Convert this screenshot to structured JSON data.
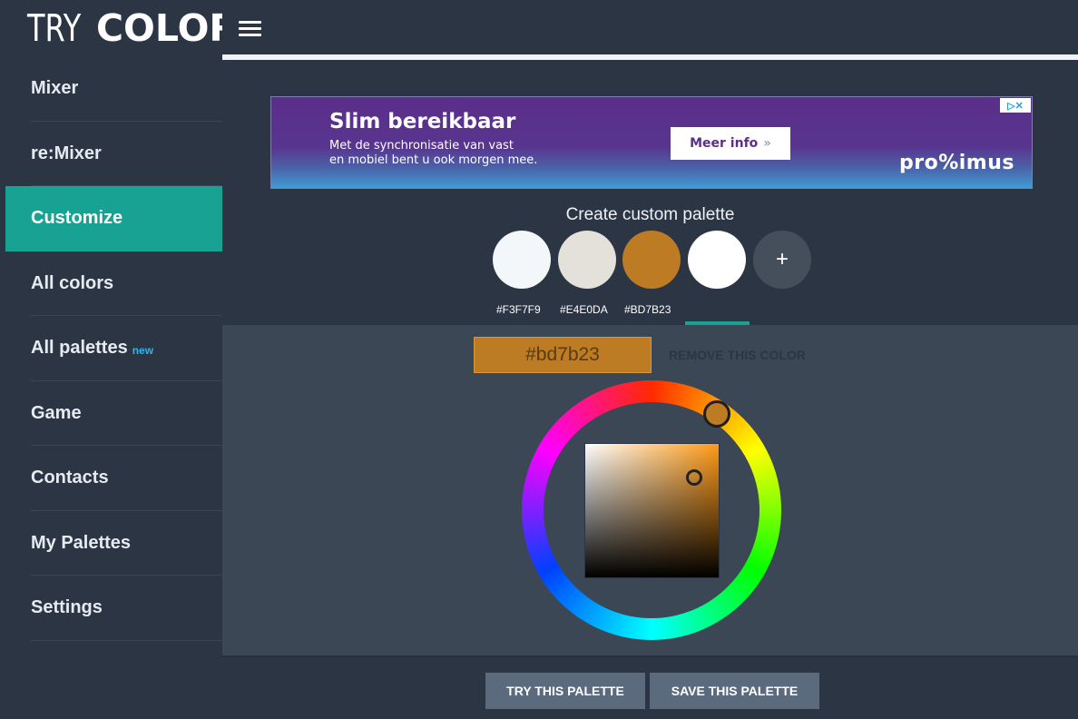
{
  "app": {
    "logo_part1": "TRY",
    "logo_part2": "COLORS"
  },
  "sidebar": {
    "items": [
      {
        "label": "Mixer"
      },
      {
        "label": "re:Mixer"
      },
      {
        "label": "Customize",
        "active": true
      },
      {
        "label": "All colors"
      },
      {
        "label": "All palettes",
        "badge": "new"
      },
      {
        "label": "Game"
      },
      {
        "label": "Contacts"
      },
      {
        "label": "My Palettes"
      },
      {
        "label": "Settings"
      }
    ]
  },
  "topbar": {
    "menu_icon": "hamburger-menu-icon"
  },
  "ad": {
    "title": "Slim bereikbaar",
    "line1": "Met de synchronisatie van vast",
    "line2": "en mobiel bent u ook morgen mee.",
    "button": "Meer info",
    "button_chevron": "»",
    "brand": "pro%imus",
    "ad_icons": "▷✕"
  },
  "palette": {
    "title": "Create custom palette",
    "add_label": "+",
    "swatches": [
      {
        "color": "#F3F7F9",
        "label": "#F3F7F9"
      },
      {
        "color": "#E4E0DA",
        "label": "#E4E0DA"
      },
      {
        "color": "#BD7B23",
        "label": "#BD7B23"
      },
      {
        "color": "#FFFFFF",
        "label": ""
      }
    ]
  },
  "editor": {
    "hex_value": "#bd7b23",
    "remove_label": "REMOVE THIS COLOR",
    "selected_color": "#bd7b23"
  },
  "actions": {
    "try_label": "TRY THIS PALETTE",
    "save_label": "SAVE THIS PALETTE"
  },
  "colors": {
    "sidebar_bg": "#2b3544",
    "accent": "#17a294",
    "editor_bg": "#3c4756",
    "button_bg": "#5b6b7d"
  }
}
